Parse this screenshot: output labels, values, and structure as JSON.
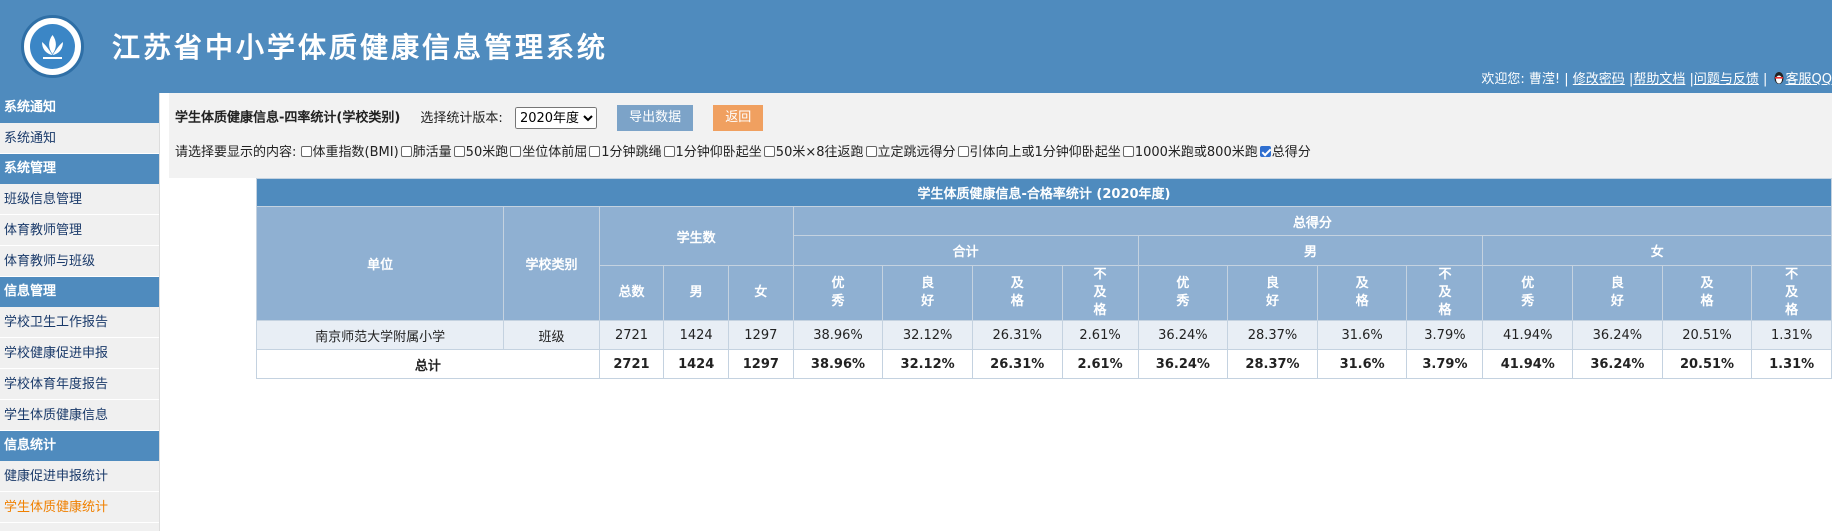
{
  "header": {
    "title": "江苏省中小学体质健康信息管理系统",
    "welcome": "欢迎您: 曹滢!",
    "links": [
      "修改密码",
      "帮助文档",
      "问题与反馈",
      "客服QQ"
    ]
  },
  "sidebar": {
    "sections": [
      {
        "title": "系统通知",
        "items": [
          "系统通知"
        ]
      },
      {
        "title": "系统管理",
        "items": [
          "班级信息管理",
          "体育教师管理",
          "体育教师与班级"
        ]
      },
      {
        "title": "信息管理",
        "items": [
          "学校卫生工作报告",
          "学校健康促进申报",
          "学校体育年度报告",
          "学生体质健康信息"
        ]
      },
      {
        "title": "信息统计",
        "items": [
          "健康促进申报统计",
          "学生体质健康统计"
        ]
      }
    ]
  },
  "toolbar": {
    "heading": "学生体质健康信息-四率统计(学校类别)",
    "version_label": "选择统计版本:",
    "version_value": "2020年度",
    "export_label": "导出数据",
    "back_label": "返回",
    "options_label": "请选择要显示的内容:",
    "options": [
      {
        "label": "体重指数(BMI)",
        "checked": false
      },
      {
        "label": "肺活量",
        "checked": false
      },
      {
        "label": "50米跑",
        "checked": false
      },
      {
        "label": "坐位体前屈",
        "checked": false
      },
      {
        "label": "1分钟跳绳",
        "checked": false
      },
      {
        "label": "1分钟仰卧起坐",
        "checked": false
      },
      {
        "label": "50米×8往返跑",
        "checked": false
      },
      {
        "label": "立定跳远得分",
        "checked": false
      },
      {
        "label": "引体向上或1分钟仰卧起坐",
        "checked": false
      },
      {
        "label": "1000米跑或800米跑",
        "checked": false
      },
      {
        "label": "总得分",
        "checked": true
      }
    ]
  },
  "table": {
    "title": "学生体质健康信息-合格率统计 (2020年度)",
    "col_unit": "单位",
    "col_type": "学校类别",
    "col_students": "学生数",
    "col_score": "总得分",
    "groups": [
      "合计",
      "男",
      "女"
    ],
    "student_cols": [
      "总数",
      "男",
      "女"
    ],
    "grade_cols": [
      "优秀",
      "良好",
      "及格",
      "不及格"
    ],
    "rows": [
      {
        "unit": "南京师范大学附属小学",
        "type": "班级",
        "counts": [
          "2721",
          "1424",
          "1297"
        ],
        "rates": [
          "38.96%",
          "32.12%",
          "26.31%",
          "2.61%",
          "36.24%",
          "28.37%",
          "31.6%",
          "3.79%",
          "41.94%",
          "36.24%",
          "20.51%",
          "1.31%"
        ]
      }
    ],
    "total": {
      "label": "总计",
      "counts": [
        "2721",
        "1424",
        "1297"
      ],
      "rates": [
        "38.96%",
        "32.12%",
        "26.31%",
        "2.61%",
        "36.24%",
        "28.37%",
        "31.6%",
        "3.79%",
        "41.94%",
        "36.24%",
        "20.51%",
        "1.31%"
      ]
    }
  }
}
